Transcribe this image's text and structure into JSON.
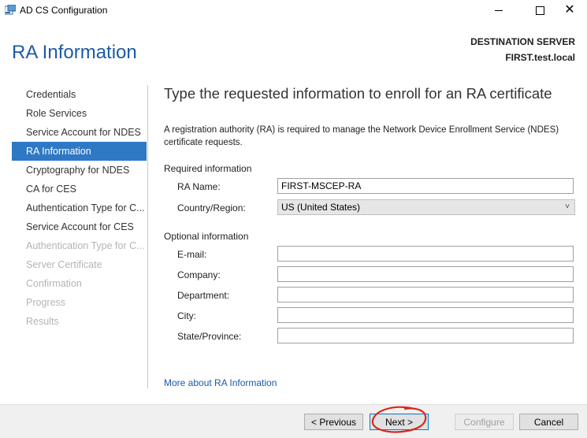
{
  "window": {
    "title": "AD CS Configuration"
  },
  "header": {
    "page_title": "RA Information",
    "destination_label": "DESTINATION SERVER",
    "destination_server": "FIRST.test.local"
  },
  "sidebar": {
    "items": [
      {
        "label": "Credentials",
        "state": "normal"
      },
      {
        "label": "Role Services",
        "state": "normal"
      },
      {
        "label": "Service Account for NDES",
        "state": "normal"
      },
      {
        "label": "RA Information",
        "state": "active"
      },
      {
        "label": "Cryptography for NDES",
        "state": "normal"
      },
      {
        "label": "CA for CES",
        "state": "normal"
      },
      {
        "label": "Authentication Type for C...",
        "state": "normal"
      },
      {
        "label": "Service Account for CES",
        "state": "normal"
      },
      {
        "label": "Authentication Type for C...",
        "state": "disabled"
      },
      {
        "label": "Server Certificate",
        "state": "disabled"
      },
      {
        "label": "Confirmation",
        "state": "disabled"
      },
      {
        "label": "Progress",
        "state": "disabled"
      },
      {
        "label": "Results",
        "state": "disabled"
      }
    ]
  },
  "main": {
    "heading": "Type the requested information to enroll for an RA certificate",
    "description": "A registration authority (RA) is required to manage the Network Device Enrollment Service (NDES) certificate requests.",
    "required_section": "Required information",
    "ra_name_label": "RA Name:",
    "ra_name_value": "FIRST-MSCEP-RA",
    "country_label": "Country/Region:",
    "country_value": "US (United States)",
    "optional_section": "Optional information",
    "email_label": "E-mail:",
    "company_label": "Company:",
    "department_label": "Department:",
    "city_label": "City:",
    "state_label": "State/Province:",
    "more_link": "More about RA Information"
  },
  "footer": {
    "previous_label": "< Previous",
    "next_label": "Next >",
    "configure_label": "Configure",
    "cancel_label": "Cancel"
  },
  "colors": {
    "accent": "#1c5aa6",
    "active_nav": "#2f78c3",
    "annotation": "#d9261c"
  }
}
